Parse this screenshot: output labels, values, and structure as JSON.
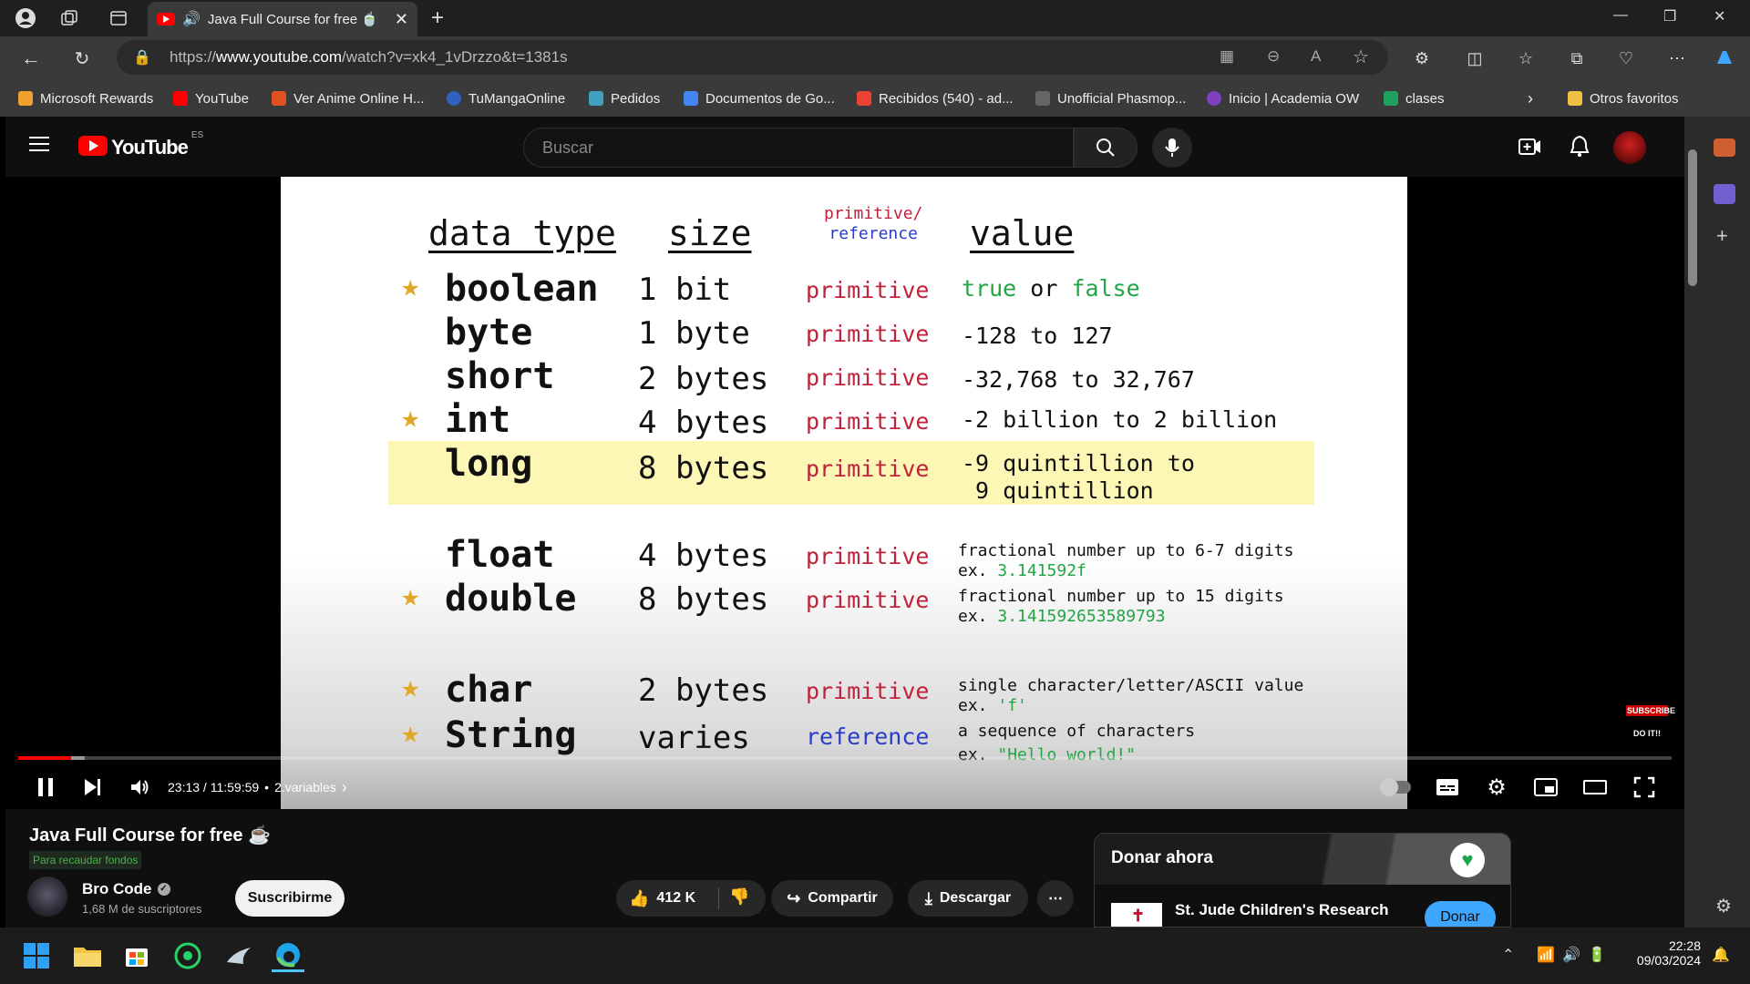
{
  "browser": {
    "tab_title": "Java Full Course for free 🍵",
    "url_prefix": "https://",
    "url_domain": "www.youtube.com",
    "url_path": "/watch?v=xk4_1vDrzzo&t=1381s",
    "bookmarks": [
      {
        "label": "Microsoft Rewards",
        "color": "#f0a030"
      },
      {
        "label": "YouTube",
        "color": "#ff0000"
      },
      {
        "label": "Ver Anime Online H...",
        "color": "#e05020"
      },
      {
        "label": "TuMangaOnline",
        "color": "#3060c0"
      },
      {
        "label": "Pedidos",
        "color": "#40a0c0"
      },
      {
        "label": "Documentos de Go...",
        "color": "#4285f4"
      },
      {
        "label": "Recibidos (540) - ad...",
        "color": "#ea4335"
      },
      {
        "label": "Unofficial Phasmop...",
        "color": "#cccccc"
      },
      {
        "label": "Inicio | Academia OW",
        "color": "#8040c0"
      },
      {
        "label": "clases",
        "color": "#20a060"
      }
    ],
    "other_favorites": "Otros favoritos"
  },
  "youtube": {
    "logo_text": "YouTube",
    "region": "ES",
    "search_placeholder": "Buscar"
  },
  "slide": {
    "headers": {
      "data_type": "data type",
      "size": "size",
      "primitive": "primitive/",
      "reference": "reference",
      "value": "value"
    },
    "rows": [
      {
        "type": "boolean",
        "size": "1 bit",
        "kind": "primitive",
        "star": true,
        "value": "true or false"
      },
      {
        "type": "byte",
        "size": "1 byte",
        "kind": "primitive",
        "star": false,
        "value": "-128 to 127"
      },
      {
        "type": "short",
        "size": "2 bytes",
        "kind": "primitive",
        "star": false,
        "value": "-32,768 to 32,767"
      },
      {
        "type": "int",
        "size": "4 bytes",
        "kind": "primitive",
        "star": true,
        "value": "-2 billion to 2 billion"
      },
      {
        "type": "long",
        "size": "8 bytes",
        "kind": "primitive",
        "star": false,
        "value_line1": "-9 quintillion to",
        "value_line2": " 9 quintillion"
      },
      {
        "type": "float",
        "size": "4 bytes",
        "kind": "primitive",
        "star": false,
        "value_line1": "fractional number up to 6-7 digits",
        "example_prefix": "ex. ",
        "example": "3.141592f"
      },
      {
        "type": "double",
        "size": "8 bytes",
        "kind": "primitive",
        "star": true,
        "value_line1": "fractional number up to 15 digits",
        "example_prefix": "ex. ",
        "example": "3.141592653589793"
      },
      {
        "type": "char",
        "size": "2 bytes",
        "kind": "primitive",
        "star": true,
        "value_line1": "single character/letter/ASCII value",
        "example_prefix": "ex. ",
        "example": "'f'"
      },
      {
        "type": "String",
        "size": "varies",
        "kind": "reference",
        "star": true,
        "value_line1": "a sequence of characters",
        "example_prefix": "ex. ",
        "example": "\"Hello world!\""
      }
    ],
    "boolean_true": "true",
    "boolean_or": " or ",
    "boolean_false": "false",
    "subscribe_overlay": "SUBSCRIBE",
    "doit_overlay": "DO IT!!"
  },
  "player": {
    "time": "23:13 / 11:59:59",
    "chapter_sep": "•",
    "chapter": "2.variables",
    "progress": 0.0322
  },
  "video": {
    "title": "Java Full Course for free ☕",
    "fundraiser_badge": "Para recaudar fondos",
    "channel": "Bro Code",
    "subscribers": "1,68 M de suscriptores",
    "subscribe_label": "Suscribirme",
    "likes": "412 K",
    "share_label": "Compartir",
    "download_label": "Descargar"
  },
  "donate": {
    "title": "Donar ahora",
    "org": "St. Jude Children's Research",
    "button": "Donar"
  },
  "taskbar": {
    "time": "22:28",
    "date": "09/03/2024"
  },
  "colors": {
    "accent_red": "#ff0000",
    "primitive_red": "#c0223b",
    "reference_blue": "#2a3cc8",
    "green": "#22a545",
    "highlight_yellow": "#fdf7b6",
    "donate_blue": "#3ea6ff"
  }
}
